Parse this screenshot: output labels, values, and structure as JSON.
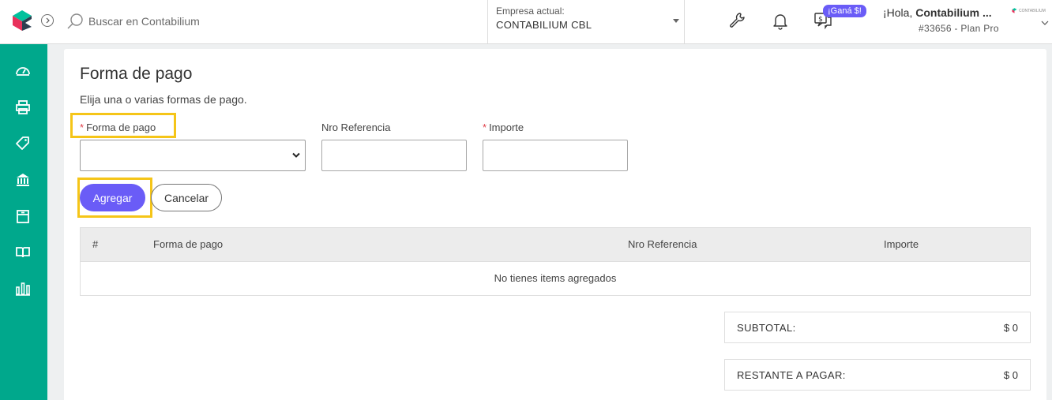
{
  "header": {
    "search_placeholder": "Buscar en Contabilium",
    "company_label": "Empresa actual:",
    "company_name": "CONTABILIUM CBL",
    "promo_badge": "¡Ganá $!",
    "greeting_prefix": "¡Hola,",
    "greeting_name": "Contabilium ...",
    "plan": "#33656 - Plan Pro",
    "user_logo_text": "CONTABILIUM"
  },
  "sidebar": {
    "items": [
      {
        "icon": "dashboard-gauge-icon"
      },
      {
        "icon": "printer-icon"
      },
      {
        "icon": "tag-icon"
      },
      {
        "icon": "bank-icon"
      },
      {
        "icon": "box-icon"
      },
      {
        "icon": "book-icon"
      },
      {
        "icon": "bar-chart-icon"
      }
    ]
  },
  "form": {
    "title": "Forma de pago",
    "subtitle": "Elija una o varias formas de pago.",
    "required_mark": "*",
    "payment_method_label": "Forma de pago",
    "reference_label": "Nro Referencia",
    "amount_label": "Importe",
    "add_button": "Agregar",
    "cancel_button": "Cancelar"
  },
  "table": {
    "columns": [
      "#",
      "Forma de pago",
      "Nro Referencia",
      "Importe"
    ],
    "empty_message": "No tienes items agregados"
  },
  "totals": {
    "subtotal_label": "SUBTOTAL:",
    "subtotal_value": "$ 0",
    "remaining_label": "RESTANTE A PAGAR:",
    "remaining_value": "$ 0"
  },
  "colors": {
    "brand_green": "#00a88c",
    "accent_purple": "#6a5cf7",
    "highlight_yellow": "#f5c518"
  }
}
